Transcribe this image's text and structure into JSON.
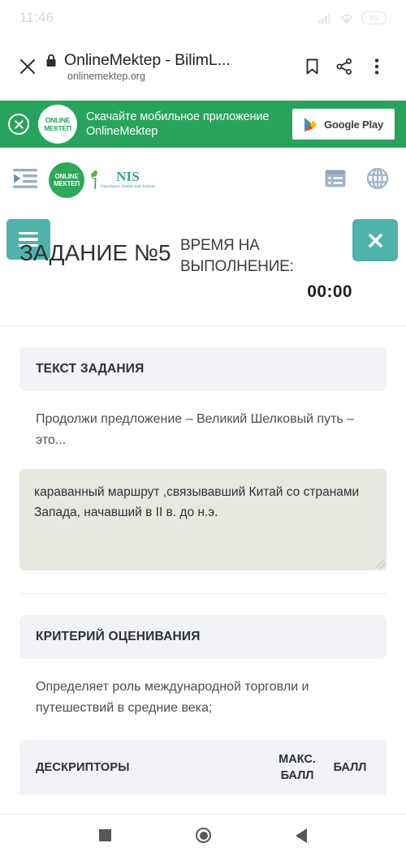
{
  "status_bar": {
    "time": "11:46",
    "battery_level": "85",
    "icons": [
      "signal-icon",
      "wifi-icon",
      "battery-icon"
    ]
  },
  "browser": {
    "close_icon": "close-icon",
    "lock_icon": "lock-icon",
    "page_title": "OnlineMektep - BilimL...",
    "host": "onlinemektep.org",
    "bookmark_icon": "bookmark-icon",
    "share_icon": "share-icon",
    "menu_icon": "overflow-menu-icon"
  },
  "promo_banner": {
    "close_icon": "close-circle-icon",
    "logo_line1": "ONLINE",
    "logo_line2": "МЕКТЕП",
    "text": "Скачайте мобильное приложение OnlineMektep",
    "store_button_label": "Google Play",
    "background_color": "#28a35b"
  },
  "site_nav": {
    "menu_icon": "indent-menu-icon",
    "brand_line1": "ONLINE",
    "brand_line2": "МЕКТЕП",
    "nis_name": "NIS",
    "nis_subtitle": "Nazarbayev Intellectual Schools",
    "list_icon": "list-view-icon",
    "language_icon": "globe-icon",
    "brand_green": "#2fa85c",
    "nis_teal": "#3f9e9a"
  },
  "task_header": {
    "burger_icon": "hamburger-menu-icon",
    "close_icon": "close-icon",
    "title": "ЗАДАНИЕ №5",
    "timer_label": "ВРЕМЯ НА ВЫПОЛНЕНИЕ:",
    "timer_value": "00:00",
    "accent_color": "#4fb3ac"
  },
  "task_text_section": {
    "heading": "ТЕКСТ ЗАДАНИЯ",
    "body": "Продолжи предложение – Великий Шелковый путь – это..."
  },
  "answer": {
    "value": "караванный маршрут ,связывавший Китай со странами Запада, начавший в II в. до н.э.",
    "placeholder": "",
    "resize_handle": "resize-grip-icon"
  },
  "criteria_section": {
    "heading": "КРИТЕРИЙ ОЦЕНИВАНИЯ",
    "body": "Определяет роль международной торговли и путешествий в средние века;"
  },
  "descriptors_table": {
    "columns": [
      "ДЕСКРИПТОРЫ",
      "МАКС. БАЛЛ",
      "БАЛЛ"
    ],
    "col_max_line1": "МАКС.",
    "col_max_line2": "БАЛЛ",
    "rows": []
  },
  "android_nav": {
    "recents_icon": "recents-square-icon",
    "home_icon": "home-circle-icon",
    "back_icon": "back-triangle-icon"
  }
}
